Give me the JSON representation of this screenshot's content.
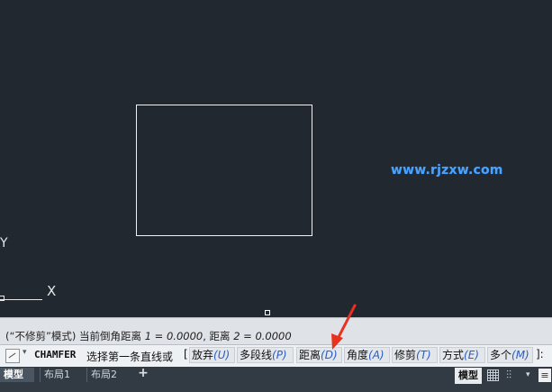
{
  "watermark": "www.rjzxw.com",
  "ucs": {
    "y_label": "Y",
    "x_label": "X"
  },
  "history": {
    "prefix": "(“不修剪”模式) 当前倒角距离 ",
    "d1": "1 = 0.0000",
    "mid": ", 距离 ",
    "d2": "2 = 0.0000"
  },
  "command_line": {
    "command": "CHAMFER",
    "prompt": "选择第一条直线或",
    "open_bracket": "[",
    "close_bracket": "]:",
    "options": [
      {
        "label": "放弃",
        "key": "(U)"
      },
      {
        "label": "多段线",
        "key": "(P)"
      },
      {
        "label": "距离",
        "key": "(D)"
      },
      {
        "label": "角度",
        "key": "(A)"
      },
      {
        "label": "修剪",
        "key": "(T)"
      },
      {
        "label": "方式",
        "key": "(E)"
      },
      {
        "label": "多个",
        "key": "(M)"
      }
    ]
  },
  "layout_tabs": {
    "model": "模型",
    "layout1": "布局1",
    "layout2": "布局2",
    "add": "+"
  },
  "status_bar": {
    "model_button": "模型"
  },
  "colors": {
    "canvas": "#212830",
    "arrow": "#e8321f",
    "watermark": "#4aa3ff"
  }
}
